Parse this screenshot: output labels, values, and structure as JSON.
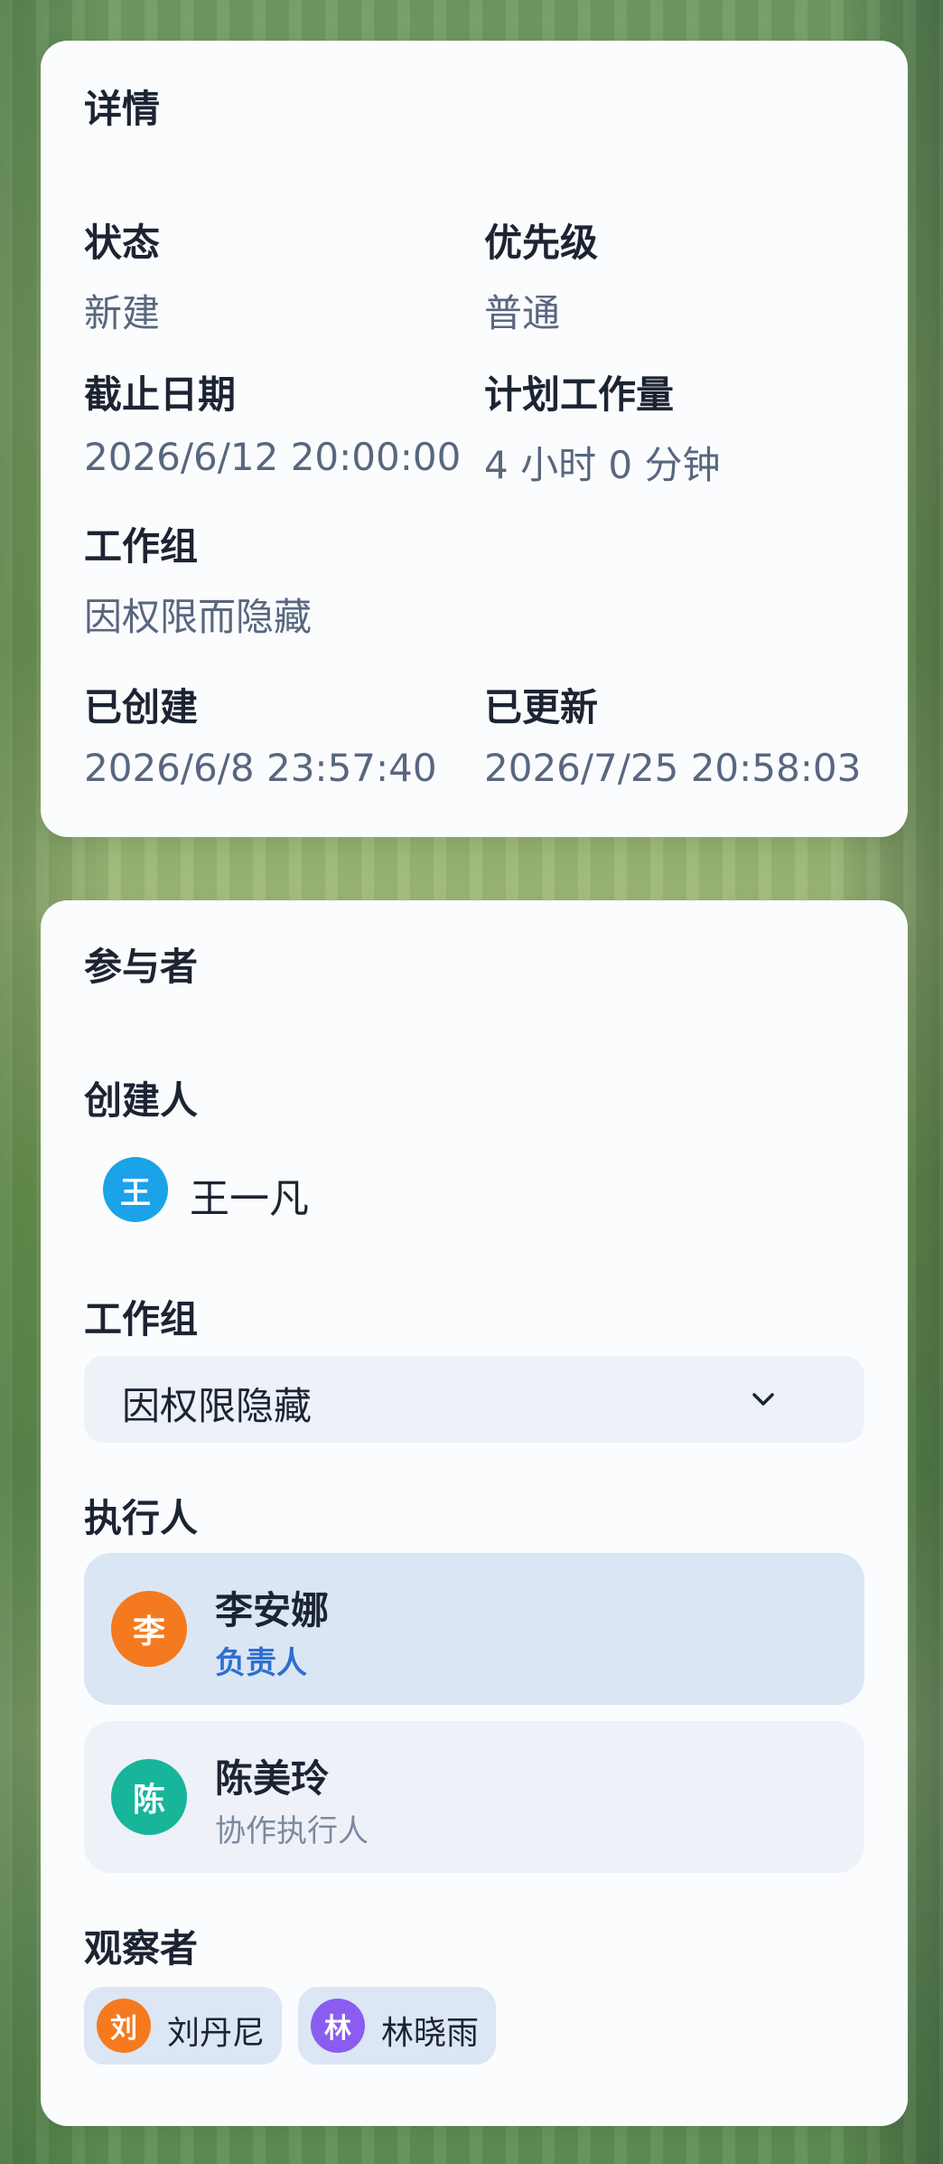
{
  "details": {
    "title": "详情",
    "status": {
      "label": "状态",
      "value": "新建"
    },
    "priority": {
      "label": "优先级",
      "value": "普通"
    },
    "due_date": {
      "label": "截止日期",
      "value": "2026/6/12 20:00:00"
    },
    "planned_effort": {
      "label": "计划工作量",
      "value": "4 小时 0 分钟"
    },
    "work_group": {
      "label": "工作组",
      "value": "因权限而隐藏"
    },
    "created": {
      "label": "已创建",
      "value": "2026/6/8 23:57:40"
    },
    "updated": {
      "label": "已更新",
      "value": "2026/7/25 20:58:03"
    }
  },
  "participants": {
    "title": "参与者",
    "creator": {
      "label": "创建人",
      "avatar_initial": "王",
      "avatar_color": "#1aa3e8",
      "name": "王一凡"
    },
    "work_group": {
      "label": "工作组",
      "selected": "因权限隐藏",
      "icon": "chevron-down-icon"
    },
    "assignees": {
      "label": "执行人",
      "items": [
        {
          "initial": "李",
          "color": "#f57a1f",
          "name": "李安娜",
          "role": "负责人"
        },
        {
          "initial": "陈",
          "color": "#17b59a",
          "name": "陈美玲",
          "role": "协作执行人"
        }
      ]
    },
    "watchers": {
      "label": "观察者",
      "items": [
        {
          "initial": "刘",
          "color": "#f57a1f",
          "name": "刘丹尼"
        },
        {
          "initial": "林",
          "color": "#8b5cf0",
          "name": "林晓雨"
        }
      ]
    }
  }
}
